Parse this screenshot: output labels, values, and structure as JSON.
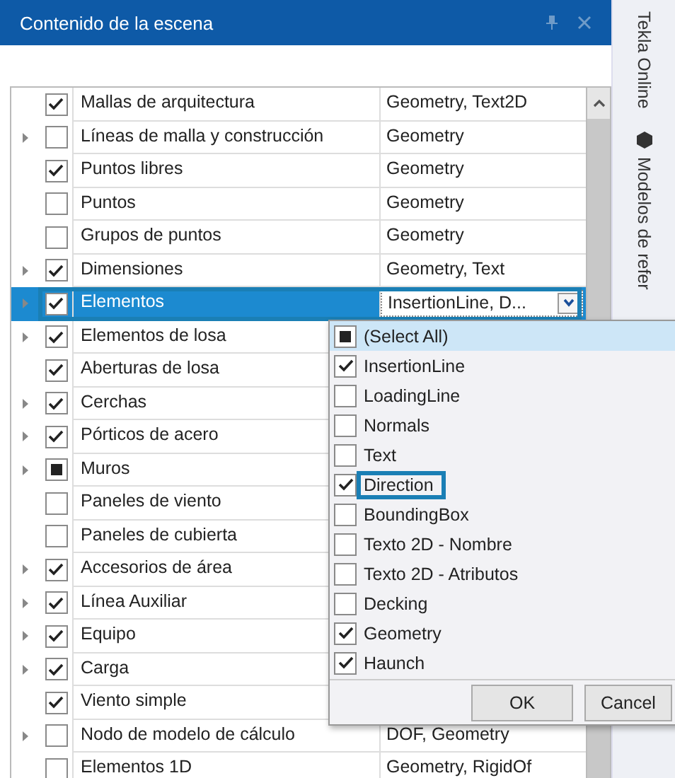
{
  "panel": {
    "title": "Contenido de la escena"
  },
  "rows": [
    {
      "label": "Mallas de arquitectura",
      "value": "Geometry, Text2D",
      "checked": true,
      "partial": false,
      "expandable": false,
      "selected": false
    },
    {
      "label": "Líneas de malla y construcción",
      "value": "Geometry",
      "checked": false,
      "partial": false,
      "expandable": true,
      "selected": false
    },
    {
      "label": "Puntos libres",
      "value": "Geometry",
      "checked": true,
      "partial": false,
      "expandable": false,
      "selected": false
    },
    {
      "label": "Puntos",
      "value": "Geometry",
      "checked": false,
      "partial": false,
      "expandable": false,
      "selected": false
    },
    {
      "label": "Grupos de puntos",
      "value": "Geometry",
      "checked": false,
      "partial": false,
      "expandable": false,
      "selected": false
    },
    {
      "label": "Dimensiones",
      "value": "Geometry, Text",
      "checked": true,
      "partial": false,
      "expandable": true,
      "selected": false
    },
    {
      "label": "Elementos",
      "editor_value": "InsertionLine, D...",
      "checked": true,
      "partial": false,
      "expandable": true,
      "selected": true
    },
    {
      "label": "Elementos de losa",
      "checked": true,
      "partial": false,
      "expandable": true,
      "selected": false
    },
    {
      "label": "Aberturas de losa",
      "checked": true,
      "partial": false,
      "expandable": false,
      "selected": false
    },
    {
      "label": "Cerchas",
      "checked": true,
      "partial": false,
      "expandable": true,
      "selected": false
    },
    {
      "label": "Pórticos de acero",
      "checked": true,
      "partial": false,
      "expandable": true,
      "selected": false
    },
    {
      "label": "Muros",
      "checked": false,
      "partial": true,
      "expandable": true,
      "selected": false
    },
    {
      "label": "Paneles de viento",
      "checked": false,
      "partial": false,
      "expandable": false,
      "selected": false
    },
    {
      "label": "Paneles de cubierta",
      "checked": false,
      "partial": false,
      "expandable": false,
      "selected": false
    },
    {
      "label": "Accesorios de área",
      "checked": true,
      "partial": false,
      "expandable": true,
      "selected": false
    },
    {
      "label": "Línea Auxiliar",
      "checked": true,
      "partial": false,
      "expandable": true,
      "selected": false
    },
    {
      "label": "Equipo",
      "checked": true,
      "partial": false,
      "expandable": true,
      "selected": false
    },
    {
      "label": "Carga",
      "checked": true,
      "partial": false,
      "expandable": true,
      "selected": false
    },
    {
      "label": "Viento simple",
      "checked": true,
      "partial": false,
      "expandable": false,
      "selected": false
    },
    {
      "label": "Nodo de modelo de cálculo",
      "value": "DOF, Geometry",
      "checked": false,
      "partial": false,
      "expandable": true,
      "selected": false
    },
    {
      "label": "Elementos 1D",
      "value": "Geometry, RigidOf",
      "checked": false,
      "partial": false,
      "expandable": false,
      "selected": false
    }
  ],
  "popup": {
    "items": [
      {
        "label": "(Select All)",
        "checked": false,
        "partial": true,
        "hovered": true,
        "focused": false
      },
      {
        "label": "InsertionLine",
        "checked": true,
        "partial": false,
        "hovered": false,
        "focused": false
      },
      {
        "label": "LoadingLine",
        "checked": false,
        "partial": false,
        "hovered": false,
        "focused": false
      },
      {
        "label": "Normals",
        "checked": false,
        "partial": false,
        "hovered": false,
        "focused": false
      },
      {
        "label": "Text",
        "checked": false,
        "partial": false,
        "hovered": false,
        "focused": false
      },
      {
        "label": "Direction",
        "checked": true,
        "partial": false,
        "hovered": false,
        "focused": true
      },
      {
        "label": "BoundingBox",
        "checked": false,
        "partial": false,
        "hovered": false,
        "focused": false
      },
      {
        "label": "Texto 2D - Nombre",
        "checked": false,
        "partial": false,
        "hovered": false,
        "focused": false
      },
      {
        "label": "Texto 2D - Atributos",
        "checked": false,
        "partial": false,
        "hovered": false,
        "focused": false
      },
      {
        "label": "Decking",
        "checked": false,
        "partial": false,
        "hovered": false,
        "focused": false
      },
      {
        "label": "Geometry",
        "checked": true,
        "partial": false,
        "hovered": false,
        "focused": false
      },
      {
        "label": "Haunch",
        "checked": true,
        "partial": false,
        "hovered": false,
        "focused": false
      }
    ],
    "buttons": [
      "OK",
      "Cancel"
    ]
  },
  "side_tabs": [
    {
      "label": "Tekla Online",
      "icon": false
    },
    {
      "label": "Modelos de refer",
      "icon": true
    }
  ]
}
